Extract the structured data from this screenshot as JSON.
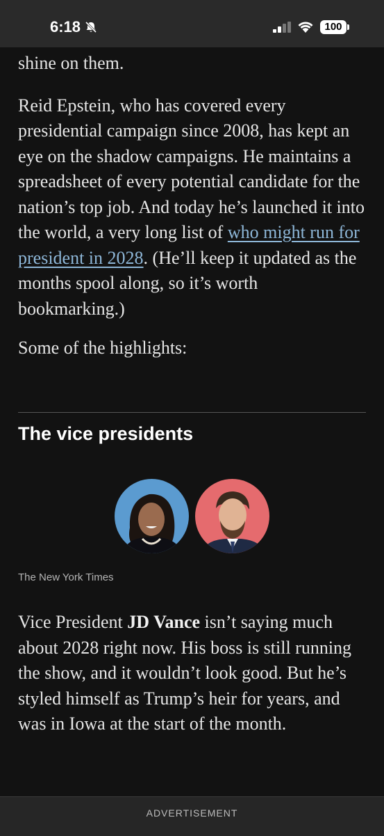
{
  "status_bar": {
    "time": "6:18",
    "battery": "100"
  },
  "article": {
    "cut_text": "shine on them.",
    "para1_before_link": "Reid Epstein, who has covered every presidential campaign since 2008, has kept an eye on the shadow campaigns. He maintains a spreadsheet of every potential candidate for the nation’s top job. And today he’s launched it into the world, a very long list of ",
    "para1_link": "who might run for president in 2028",
    "para1_after_link": ". (He’ll keep it updated as the months spool along, so it’s worth bookmarking.)",
    "highlights": "Some of the highlights:",
    "section_title": "The vice presidents",
    "credit": "The New York Times",
    "para2_before": "Vice President ",
    "para2_bold": "JD Vance",
    "para2_after": " isn’t saying much about 2028 right now. His boss is still running the show, and it wouldn’t look good. But he’s styled himself as Trump’s heir for years, and was in Iowa at the start of the month."
  },
  "advertisement": {
    "label": "ADVERTISEMENT"
  },
  "colors": {
    "background": "#121212",
    "link": "#8eb7d8",
    "avatar_left_bg": "#5b9bd0",
    "avatar_right_bg": "#e56b6e"
  }
}
